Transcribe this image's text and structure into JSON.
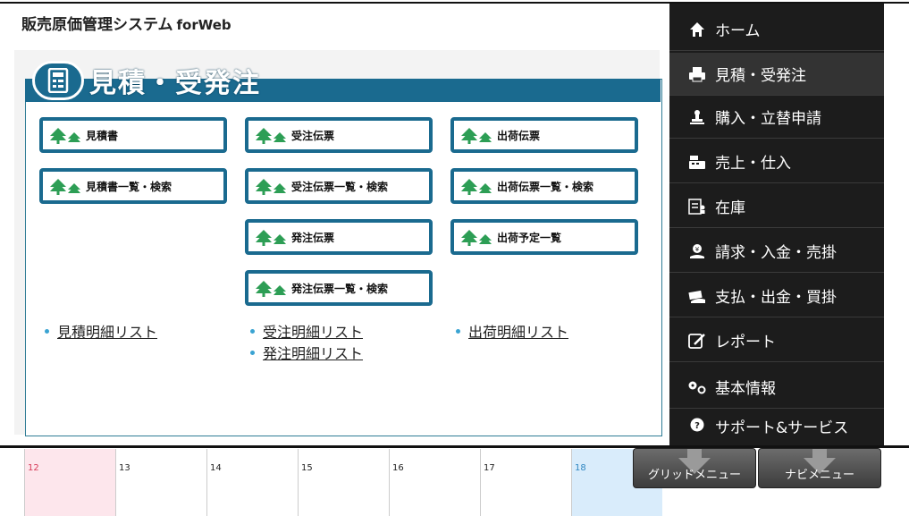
{
  "header": {
    "title": "販売原価管理システム",
    "subtitle": "forWeb"
  },
  "section": {
    "title": "見積・受発注",
    "icon": "estimate-calculator-icon"
  },
  "tiles": [
    {
      "label": "見積書"
    },
    {
      "label": "受注伝票"
    },
    {
      "label": "出荷伝票"
    },
    {
      "label": "見積書一覧・検索"
    },
    {
      "label": "受注伝票一覧・検索"
    },
    {
      "label": "出荷伝票一覧・検索"
    },
    {
      "label": "発注伝票"
    },
    {
      "label": "出荷予定一覧"
    },
    {
      "label": "発注伝票一覧・検索"
    }
  ],
  "links": {
    "col1": [
      "見積明細リスト"
    ],
    "col2": [
      "受注明細リスト",
      "発注明細リスト"
    ],
    "col3": [
      "出荷明細リスト"
    ]
  },
  "calendar": {
    "days": [
      "12",
      "13",
      "14",
      "15",
      "16",
      "17",
      "18"
    ]
  },
  "nav": {
    "items": [
      {
        "label": "ホーム",
        "icon": "home-icon"
      },
      {
        "label": "見積・受発注",
        "icon": "printer-icon"
      },
      {
        "label": "購入・立替申請",
        "icon": "stamp-icon"
      },
      {
        "label": "売上・仕入",
        "icon": "register-icon"
      },
      {
        "label": "在庫",
        "icon": "inventory-list-icon"
      },
      {
        "label": "請求・入金・売掛",
        "icon": "payment-receive-icon"
      },
      {
        "label": "支払・出金・買掛",
        "icon": "cash-payment-icon"
      },
      {
        "label": "レポート",
        "icon": "report-edit-icon"
      },
      {
        "label": "基本情報",
        "icon": "settings-gears-icon"
      },
      {
        "label": "サポート&サービス",
        "icon": "help-question-icon"
      }
    ]
  },
  "bottom_buttons": {
    "grid_menu": "グリッドメニュー",
    "navi_menu": "ナビメニュー"
  },
  "colors": {
    "primary": "#1a6a8f",
    "tree_green": "#2d9e55",
    "sidebar_bg": "#1c1c1c",
    "sunday_bg": "#fde6ec",
    "saturday_bg": "#d9ecfb"
  }
}
